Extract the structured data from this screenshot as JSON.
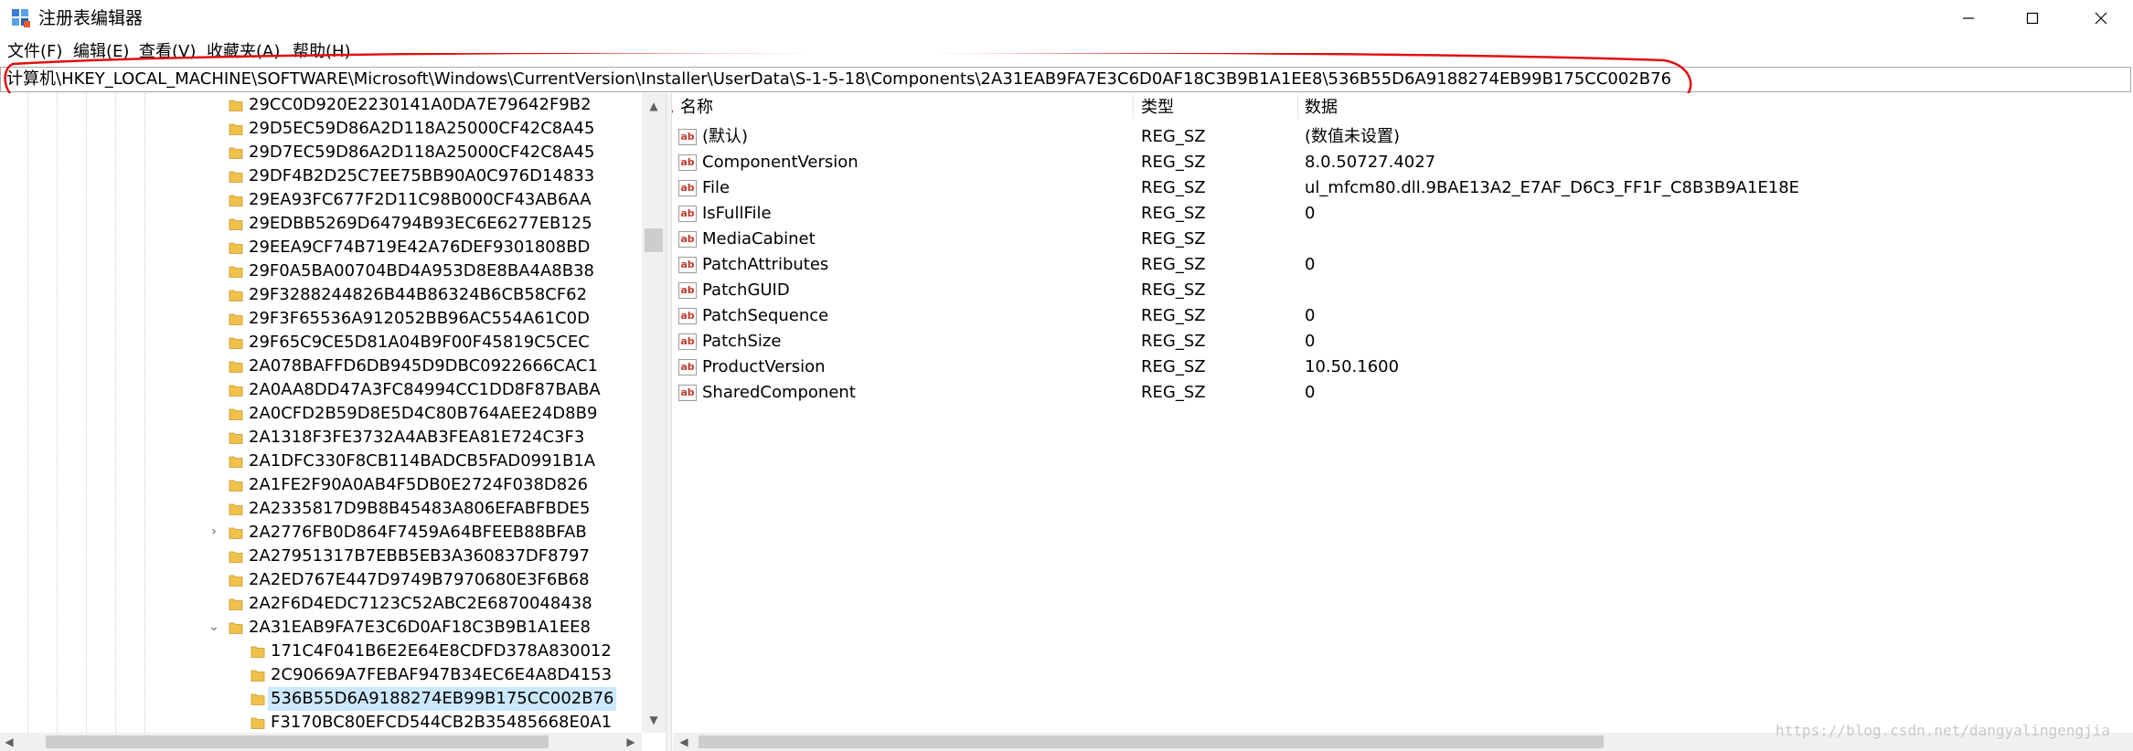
{
  "window": {
    "title": "注册表编辑器",
    "app_icon": "registry-editor-icon",
    "buttons": {
      "minimize_icon": "minimize-icon",
      "maximize_icon": "maximize-icon",
      "close_icon": "close-icon"
    }
  },
  "menu": {
    "items": [
      {
        "label": "文件(F)"
      },
      {
        "label": "编辑(E)"
      },
      {
        "label": "查看(V)"
      },
      {
        "label": "收藏夹(A)"
      },
      {
        "label": "帮助(H)"
      }
    ]
  },
  "address": {
    "path": "计算机\\HKEY_LOCAL_MACHINE\\SOFTWARE\\Microsoft\\Windows\\CurrentVersion\\Installer\\UserData\\S-1-5-18\\Components\\2A31EAB9FA7E3C6D0AF18C3B9B1A1EE8\\536B55D6A9188274EB99B175CC002B76",
    "annotation_color": "#e01010"
  },
  "tree": {
    "items": [
      {
        "label": "29CC0D920E2230141A0DA7E79642F9B2",
        "depth": 0
      },
      {
        "label": "29D5EC59D86A2D118A25000CF42C8A45",
        "depth": 0
      },
      {
        "label": "29D7EC59D86A2D118A25000CF42C8A45",
        "depth": 0
      },
      {
        "label": "29DF4B2D25C7EE75BB90A0C976D14833",
        "depth": 0
      },
      {
        "label": "29EA93FC677F2D11C98B000CF43AB6AA",
        "depth": 0
      },
      {
        "label": "29EDBB5269D64794B93EC6E6277EB125",
        "depth": 0
      },
      {
        "label": "29EEA9CF74B719E42A76DEF9301808BD",
        "depth": 0
      },
      {
        "label": "29F0A5BA00704BD4A953D8E8BA4A8B38",
        "depth": 0
      },
      {
        "label": "29F3288244826B44B86324B6CB58CF62",
        "depth": 0
      },
      {
        "label": "29F3F65536A912052BB96AC554A61C0D",
        "depth": 0
      },
      {
        "label": "29F65C9CE5D81A04B9F00F45819C5CEC",
        "depth": 0
      },
      {
        "label": "2A078BAFFD6DB945D9DBC0922666CAC1",
        "depth": 0
      },
      {
        "label": "2A0AA8DD47A3FC84994CC1DD8F87BABA",
        "depth": 0
      },
      {
        "label": "2A0CFD2B59D8E5D4C80B764AEE24D8B9",
        "depth": 0
      },
      {
        "label": "2A1318F3FE3732A4AB3FEA81E724C3F3",
        "depth": 0
      },
      {
        "label": "2A1DFC330F8CB114BADCB5FAD0991B1A",
        "depth": 0
      },
      {
        "label": "2A1FE2F90A0AB4F5DB0E2724F038D826",
        "depth": 0
      },
      {
        "label": "2A2335817D9B8B45483A806EFABFBDE5",
        "depth": 0
      },
      {
        "label": "2A2776FB0D864F7459A64BFEEB88BFAB",
        "depth": 0,
        "expander": "collapsed"
      },
      {
        "label": "2A27951317B7EBB5EB3A360837DF8797",
        "depth": 0
      },
      {
        "label": "2A2ED767E447D9749B7970680E3F6B68",
        "depth": 0
      },
      {
        "label": "2A2F6D4EDC7123C52ABC2E6870048438",
        "depth": 0
      },
      {
        "label": "2A31EAB9FA7E3C6D0AF18C3B9B1A1EE8",
        "depth": 0,
        "expander": "expanded"
      },
      {
        "label": "171C4F041B6E2E64E8CDFD378A830012",
        "depth": 1
      },
      {
        "label": "2C90669A7FEBAF947B34EC6E4A8D4153",
        "depth": 1
      },
      {
        "label": "536B55D6A9188274EB99B175CC002B76",
        "depth": 1,
        "selected": true
      },
      {
        "label": "F3170BC80EFCD544CB2B35485668E0A1",
        "depth": 1
      }
    ]
  },
  "list": {
    "columns": {
      "name": "名称",
      "type": "类型",
      "data": "数据"
    },
    "rows": [
      {
        "name": "(默认)",
        "type": "REG_SZ",
        "data": "(数值未设置)"
      },
      {
        "name": "ComponentVersion",
        "type": "REG_SZ",
        "data": "8.0.50727.4027"
      },
      {
        "name": "File",
        "type": "REG_SZ",
        "data": "ul_mfcm80.dll.9BAE13A2_E7AF_D6C3_FF1F_C8B3B9A1E18E"
      },
      {
        "name": "IsFullFile",
        "type": "REG_SZ",
        "data": "0"
      },
      {
        "name": "MediaCabinet",
        "type": "REG_SZ",
        "data": ""
      },
      {
        "name": "PatchAttributes",
        "type": "REG_SZ",
        "data": "0"
      },
      {
        "name": "PatchGUID",
        "type": "REG_SZ",
        "data": ""
      },
      {
        "name": "PatchSequence",
        "type": "REG_SZ",
        "data": "0"
      },
      {
        "name": "PatchSize",
        "type": "REG_SZ",
        "data": "0"
      },
      {
        "name": "ProductVersion",
        "type": "REG_SZ",
        "data": "10.50.1600"
      },
      {
        "name": "SharedComponent",
        "type": "REG_SZ",
        "data": "0"
      }
    ],
    "value_icon": "reg-sz-ab-icon"
  },
  "watermark": "https://blog.csdn.net/dangyalingengjia",
  "colors": {
    "selection": "#cce8ff",
    "folder": "#f0c14b"
  }
}
